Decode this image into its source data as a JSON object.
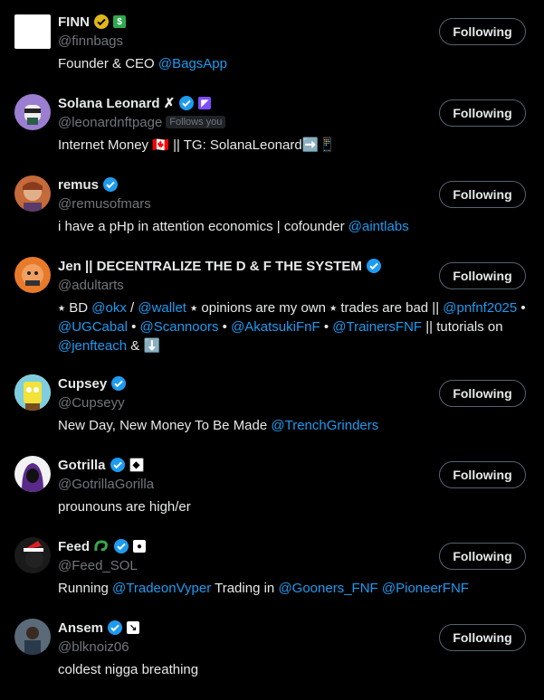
{
  "follow_label": "Following",
  "follows_you": "Follows you",
  "users": [
    {
      "name": "FINN",
      "handle": "@finnbags",
      "bio": [
        "Founder & CEO ",
        "@BagsApp"
      ]
    },
    {
      "name": "Solana Leonard ✗",
      "handle": "@leonardnftpage",
      "bio": [
        "Internet Money 🇨🇦 || TG: SolanaLeonard➡️📱"
      ]
    },
    {
      "name": "remus",
      "handle": "@remusofmars",
      "bio": [
        "i have a pHp in attention economics | cofounder ",
        "@aintlabs"
      ]
    },
    {
      "name": "Jen || DECENTRALIZE THE D & F THE SYSTEM",
      "handle": "@adultarts",
      "bio": [
        "⭑ BD ",
        "@okx",
        " / ",
        "@wallet",
        " ⭑ opinions are my own ⭑ trades are bad || ",
        "@pnfnf2025",
        " • ",
        "@UGCabal",
        " • ",
        "@Scannoors",
        " • ",
        "@AkatsukiFnF",
        " • ",
        "@TrainersFNF",
        " || tutorials on ",
        "@jenfteach",
        " & ⬇️"
      ]
    },
    {
      "name": "Cupsey",
      "handle": "@Cupseyy",
      "bio": [
        "New Day, New Money To Be Made ",
        "@TrenchGrinders"
      ]
    },
    {
      "name": "Gotrilla",
      "handle": "@GotrillaGorilla",
      "bio": [
        "prounouns are high/er"
      ]
    },
    {
      "name": "Feed",
      "handle": "@Feed_SOL",
      "bio": [
        "Running ",
        "@TradeonVyper",
        " Trading in ",
        "@Gooners_FNF",
        " ",
        "@PioneerFNF"
      ]
    },
    {
      "name": "Ansem",
      "handle": "@blknoiz06",
      "bio": [
        "coldest nigga breathing"
      ]
    }
  ]
}
